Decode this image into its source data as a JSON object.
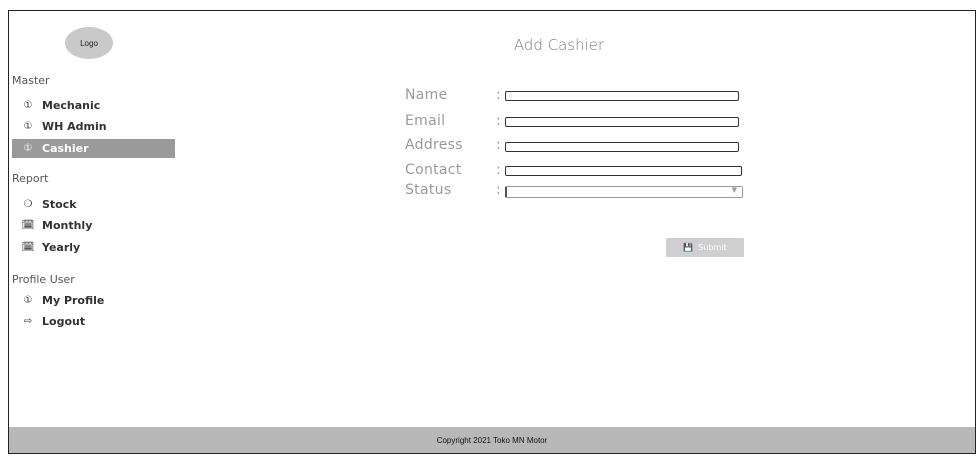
{
  "logo": "Logo",
  "sidebar": {
    "sections": [
      {
        "label": "Master",
        "items": [
          {
            "label": "Mechanic",
            "icon": "user-circle-icon"
          },
          {
            "label": "WH Admin",
            "icon": "user-circle-icon"
          },
          {
            "label": "Cashier",
            "icon": "user-circle-icon",
            "active": true
          }
        ]
      },
      {
        "label": "Report",
        "items": [
          {
            "label": "Stock",
            "icon": "box-icon"
          },
          {
            "label": "Monthly",
            "icon": "calendar-icon"
          },
          {
            "label": "Yearly",
            "icon": "calendar-icon"
          }
        ]
      },
      {
        "label": "Profile User",
        "items": [
          {
            "label": "My Profile",
            "icon": "user-circle-icon"
          },
          {
            "label": "Logout",
            "icon": "logout-icon"
          }
        ]
      }
    ]
  },
  "form": {
    "title": "Add Cashier",
    "colon": ":",
    "fields": [
      {
        "label": "Name",
        "value": ""
      },
      {
        "label": "Email",
        "value": ""
      },
      {
        "label": "Address",
        "value": ""
      },
      {
        "label": "Contact",
        "value": ""
      },
      {
        "label": "Status",
        "value": ""
      }
    ],
    "submit_label": "Submit",
    "submit_icon": "save-icon"
  },
  "footer": {
    "text": "Copyright 2021 Toko MN Motor"
  },
  "colors": {
    "active_bg": "#9a9a9a",
    "footer_bg": "#b8b8b8",
    "button_bg": "#cfcfcf"
  }
}
